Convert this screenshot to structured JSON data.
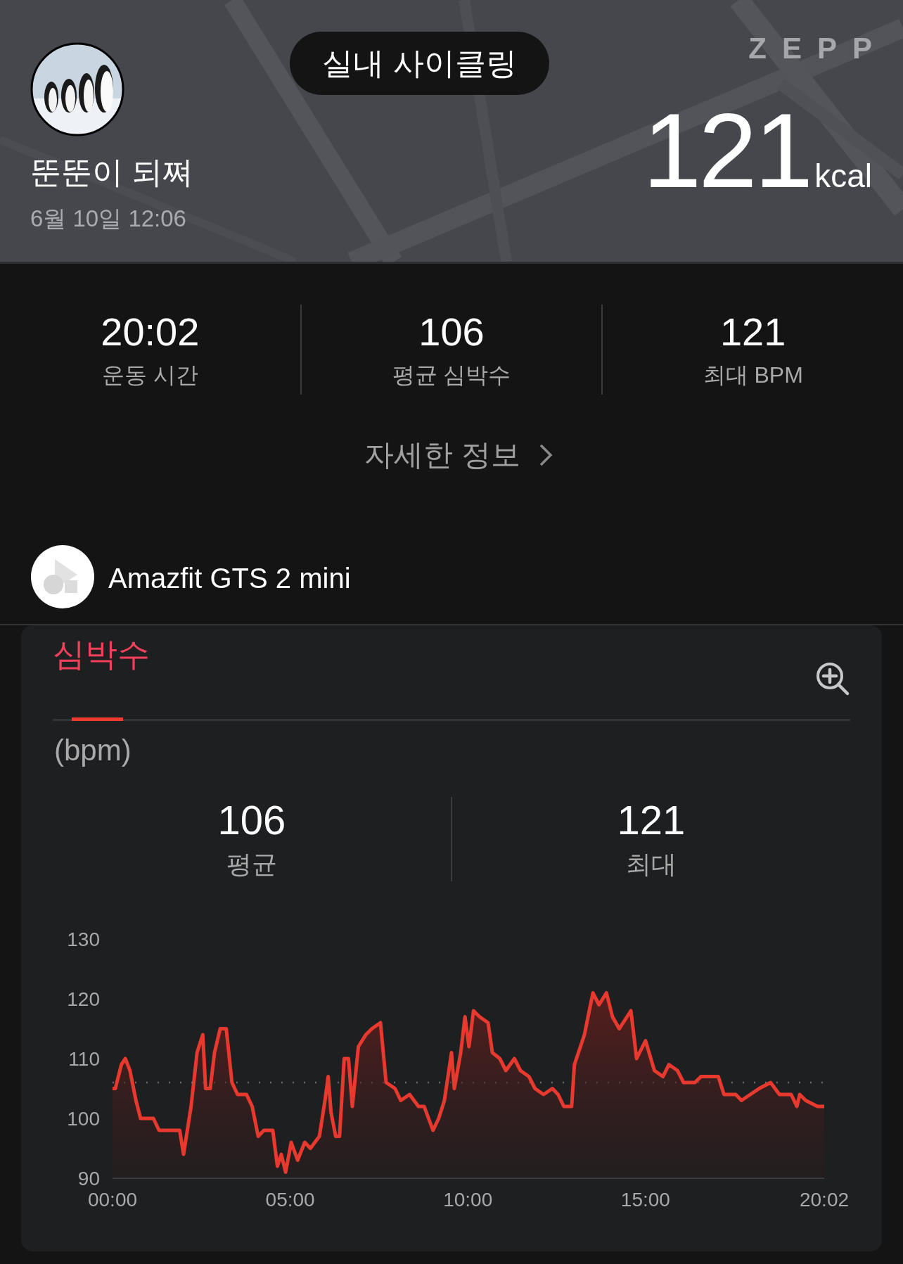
{
  "header": {
    "activity": "실내 사이클링",
    "brand": "ZEPP",
    "user_name": "뚠뚠이 되쪄",
    "date_time": "6월 10일 12:06",
    "calories": "121",
    "calories_unit": "kcal"
  },
  "summary": [
    {
      "value": "20:02",
      "label": "운동 시간"
    },
    {
      "value": "106",
      "label": "평균 심박수"
    },
    {
      "value": "121",
      "label": "최대 BPM"
    }
  ],
  "details_link": "자세한 정보",
  "device": {
    "name": "Amazfit GTS 2 mini"
  },
  "heart_rate_card": {
    "tabs": [
      {
        "label": "심박수",
        "selected": true
      }
    ],
    "unit": "(bpm)",
    "stats": [
      {
        "value": "106",
        "label": "평균"
      },
      {
        "value": "121",
        "label": "최대"
      }
    ],
    "chart_data": {
      "type": "area",
      "x": [
        0,
        0.08,
        0.25,
        0.36,
        0.49,
        0.66,
        0.79,
        1.15,
        1.31,
        1.48,
        1.64,
        1.89,
        2.0,
        2.21,
        2.38,
        2.54,
        2.62,
        2.75,
        2.87,
        3.03,
        3.2,
        3.36,
        3.52,
        3.77,
        3.93,
        4.1,
        4.26,
        4.51,
        4.64,
        4.75,
        4.87,
        5.03,
        5.21,
        5.41,
        5.57,
        5.82,
        5.98,
        6.07,
        6.15,
        6.28,
        6.39,
        6.52,
        6.64,
        6.75,
        6.92,
        7.13,
        7.3,
        7.54,
        7.7,
        7.95,
        8.11,
        8.36,
        8.61,
        8.77,
        9.02,
        9.18,
        9.34,
        9.54,
        9.62,
        9.8,
        9.92,
        10.03,
        10.16,
        10.33,
        10.57,
        10.69,
        10.9,
        11.07,
        11.31,
        11.48,
        11.72,
        11.89,
        12.13,
        12.38,
        12.54,
        12.7,
        12.92,
        13.0,
        13.28,
        13.52,
        13.69,
        13.9,
        14.07,
        14.26,
        14.59,
        14.75,
        15.0,
        15.25,
        15.49,
        15.66,
        15.9,
        16.07,
        16.39,
        16.56,
        17.05,
        17.21,
        17.54,
        17.7,
        17.95,
        18.2,
        18.52,
        18.77,
        19.1,
        19.26,
        19.34,
        19.51,
        19.84,
        20.03
      ],
      "series": [
        {
          "color": "#e8392f",
          "values": [
            105,
            105,
            109,
            110,
            108,
            103,
            100,
            100,
            98,
            98,
            98,
            98,
            94,
            102,
            111,
            114,
            105,
            105,
            111,
            115,
            115,
            106,
            104,
            104,
            102,
            97,
            98,
            98,
            92,
            94,
            91,
            96,
            93,
            96,
            95,
            97,
            103,
            107,
            101,
            97,
            97,
            110,
            110,
            102,
            112,
            114,
            115,
            116,
            106,
            105,
            103,
            104,
            102,
            102,
            98,
            100,
            103,
            111,
            105,
            111,
            117,
            112,
            118,
            117,
            116,
            111,
            110,
            108,
            110,
            108,
            107,
            105,
            104,
            105,
            104,
            102,
            102,
            109,
            114,
            121,
            119,
            121,
            117,
            115,
            118,
            110,
            113,
            108,
            107,
            109,
            108,
            106,
            106,
            107,
            107,
            104,
            104,
            103,
            104,
            105,
            106,
            104,
            104,
            102,
            104,
            103,
            102,
            102
          ]
        }
      ],
      "xlim": [
        0,
        20.03
      ],
      "ylim": [
        90,
        130
      ],
      "xticks": [
        {
          "value": 0,
          "label": "00:00"
        },
        {
          "value": 5,
          "label": "05:00"
        },
        {
          "value": 10,
          "label": "10:00"
        },
        {
          "value": 15,
          "label": "15:00"
        },
        {
          "value": 20.03,
          "label": "20:02"
        }
      ],
      "yticks": [
        90,
        100,
        110,
        120,
        130
      ],
      "ref_lines": [
        {
          "axis": "y",
          "value": 106
        }
      ]
    }
  }
}
